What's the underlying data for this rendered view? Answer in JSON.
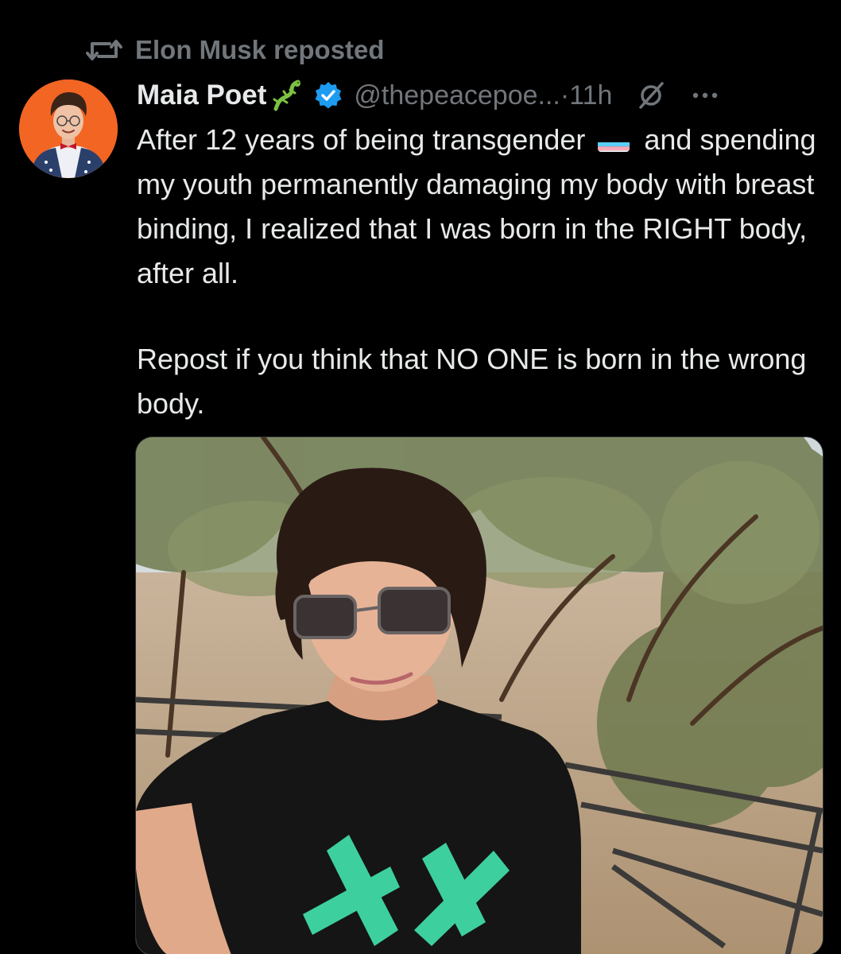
{
  "social_context": {
    "text": "Elon Musk reposted",
    "icon": "repost-icon"
  },
  "author": {
    "display_name": "Maia Poet",
    "name_emoji": "lizard-icon",
    "verified": true,
    "handle": "@thepeacepoe...",
    "separator": " · ",
    "time": "11h"
  },
  "post": {
    "paragraphs": [
      {
        "before_flag": "After 12 years of being transgender",
        "flag": "transgender-flag-icon",
        "after_flag": "and spending my youth permanently damaging my body with breast binding, I realized that I was born in the RIGHT body, after all."
      },
      {
        "text": "Repost if you think that NO ONE is born in the wrong body."
      }
    ]
  },
  "media": {
    "type": "photo",
    "icon": "selfie-photo"
  },
  "colors": {
    "background": "#000000",
    "text_primary": "#e7e9ea",
    "text_secondary": "#71767b",
    "verified_blue": "#1d9bf0",
    "avatar_bg": "#f26522"
  }
}
